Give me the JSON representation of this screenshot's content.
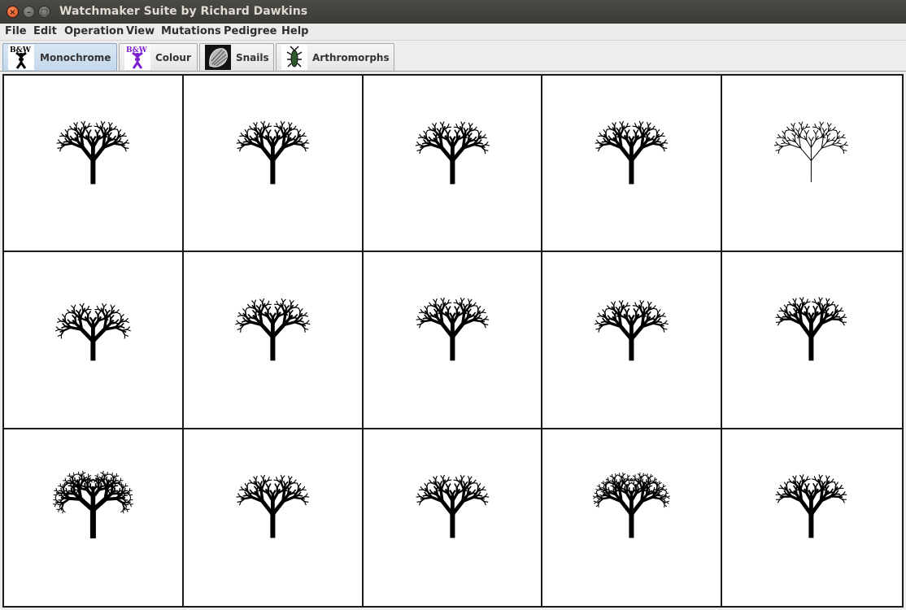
{
  "window": {
    "title": "Watchmaker Suite by Richard Dawkins",
    "controls": [
      "×",
      "–",
      "□"
    ]
  },
  "menu": [
    "File",
    "Edit",
    "Operation",
    "View",
    "Mutations",
    "Pedigree",
    "Help"
  ],
  "tabs": [
    {
      "label": "Monochrome",
      "icon": "biomorph-bw-icon",
      "active": true
    },
    {
      "label": "Colour",
      "icon": "biomorph-colour-icon",
      "active": false
    },
    {
      "label": "Snails",
      "icon": "snail-shell-icon",
      "active": false
    },
    {
      "label": "Arthromorphs",
      "icon": "arthromorph-icon",
      "active": false
    }
  ],
  "icon_lettering": {
    "bw": "B&W"
  },
  "colors": {
    "title_bar": "#3f3e3a",
    "active_tab": "#c9dcef",
    "biomorph": "#000000",
    "colour_icon": "#7b1fd0"
  },
  "grid": {
    "rows": 3,
    "cols": 5,
    "biomorphs": [
      {
        "depth": 4,
        "spread": 0.95,
        "thick": 6,
        "trunk": 1.0
      },
      {
        "depth": 4,
        "spread": 0.95,
        "thick": 6,
        "trunk": 1.0
      },
      {
        "depth": 4,
        "spread": 1.0,
        "thick": 6,
        "trunk": 1.0
      },
      {
        "depth": 4,
        "spread": 0.95,
        "thick": 6,
        "trunk": 1.0
      },
      {
        "depth": 4,
        "spread": 1.0,
        "thick": 1,
        "trunk": 1.0
      },
      {
        "depth": 4,
        "spread": 1.1,
        "thick": 6,
        "trunk": 0.8
      },
      {
        "depth": 4,
        "spread": 1.05,
        "thick": 6,
        "trunk": 1.0
      },
      {
        "depth": 4,
        "spread": 0.95,
        "thick": 6,
        "trunk": 1.0
      },
      {
        "depth": 4,
        "spread": 1.0,
        "thick": 6,
        "trunk": 0.9
      },
      {
        "depth": 4,
        "spread": 0.9,
        "thick": 6,
        "trunk": 1.0
      },
      {
        "depth": 5,
        "spread": 1.2,
        "thick": 7,
        "trunk": 1.2
      },
      {
        "depth": 4,
        "spread": 0.95,
        "thick": 6,
        "trunk": 1.0
      },
      {
        "depth": 4,
        "spread": 0.95,
        "thick": 6,
        "trunk": 1.0
      },
      {
        "depth": 5,
        "spread": 0.95,
        "thick": 6,
        "trunk": 1.0
      },
      {
        "depth": 4,
        "spread": 0.9,
        "thick": 6,
        "trunk": 1.0
      }
    ]
  }
}
